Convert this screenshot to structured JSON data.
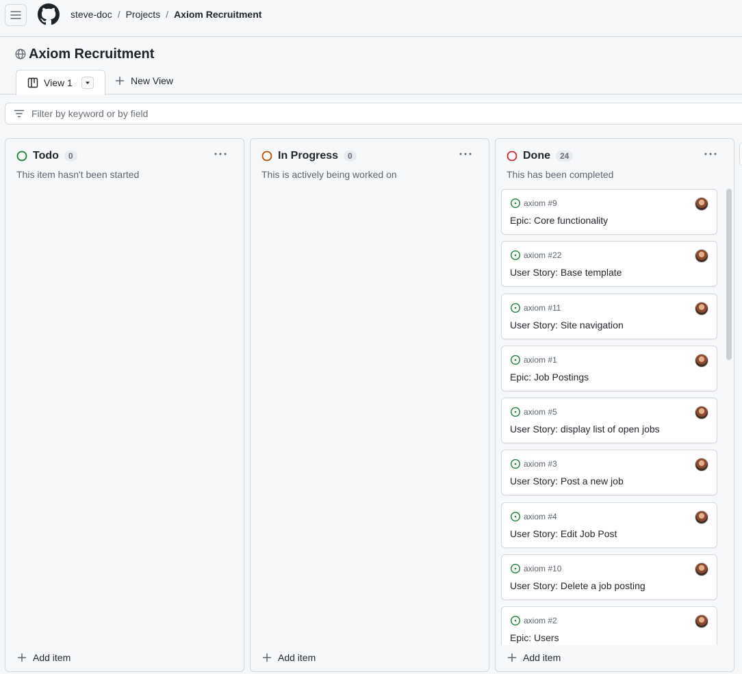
{
  "breadcrumb": {
    "owner": "steve-doc",
    "section": "Projects",
    "project": "Axiom Recruitment",
    "separator": "/"
  },
  "project": {
    "title": "Axiom Recruitment"
  },
  "tabs": [
    {
      "label": "View 1"
    },
    {
      "label": "New View"
    }
  ],
  "filter": {
    "placeholder": "Filter by keyword or by field"
  },
  "columns": [
    {
      "name": "Todo",
      "count": "0",
      "description": "This item hasn't been started",
      "status_color": "#1a7f37",
      "add_label": "Add item",
      "cards": []
    },
    {
      "name": "In Progress",
      "count": "0",
      "description": "This is actively being worked on",
      "status_color": "#bc4c00",
      "add_label": "Add item",
      "cards": []
    },
    {
      "name": "Done",
      "count": "24",
      "description": "This has been completed",
      "status_color": "#cf222e",
      "add_label": "Add item",
      "cards": [
        {
          "ref": "axiom #9",
          "title": "Epic: Core functionality"
        },
        {
          "ref": "axiom #22",
          "title": "User Story: Base template"
        },
        {
          "ref": "axiom #11",
          "title": "User Story: Site navigation"
        },
        {
          "ref": "axiom #1",
          "title": "Epic: Job Postings"
        },
        {
          "ref": "axiom #5",
          "title": "User Story: display list of open jobs"
        },
        {
          "ref": "axiom #3",
          "title": "User Story: Post a new job"
        },
        {
          "ref": "axiom #4",
          "title": "User Story: Edit Job Post"
        },
        {
          "ref": "axiom #10",
          "title": "User Story: Delete a job posting"
        },
        {
          "ref": "axiom #2",
          "title": "Epic: Users"
        }
      ]
    }
  ],
  "colors": {
    "issue_open": "#1a7f37",
    "border": "#d0d7de",
    "muted": "#59636e"
  }
}
